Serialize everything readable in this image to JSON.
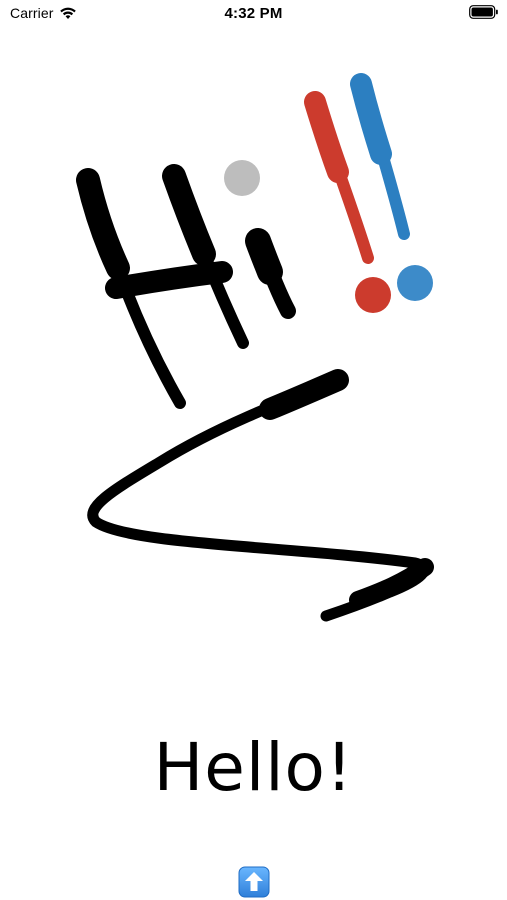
{
  "status_bar": {
    "carrier": "Carrier",
    "time": "4:32 PM",
    "wifi_icon": "wifi-icon",
    "battery_icon": "battery-full-icon"
  },
  "canvas": {
    "strokes": [
      {
        "name": "stroke-h-left",
        "color": "#000000"
      },
      {
        "name": "stroke-h-right",
        "color": "#000000"
      },
      {
        "name": "stroke-h-bar",
        "color": "#000000"
      },
      {
        "name": "stroke-i-stem",
        "color": "#000000"
      },
      {
        "name": "stroke-squiggle",
        "color": "#000000"
      },
      {
        "name": "stroke-exclamation-red",
        "color": "#cc3b2d"
      },
      {
        "name": "stroke-exclamation-blue",
        "color": "#2c7fc1"
      }
    ],
    "dots": [
      {
        "name": "dot-gray",
        "color": "#bdbdbd"
      },
      {
        "name": "dot-red",
        "color": "#cc3b2d"
      },
      {
        "name": "dot-blue",
        "color": "#3d8bc9"
      }
    ]
  },
  "message": {
    "text": "Hello!"
  },
  "toolbar": {
    "share_icon": "arrow-up-box-icon",
    "share_color": "#3a8ee6"
  }
}
